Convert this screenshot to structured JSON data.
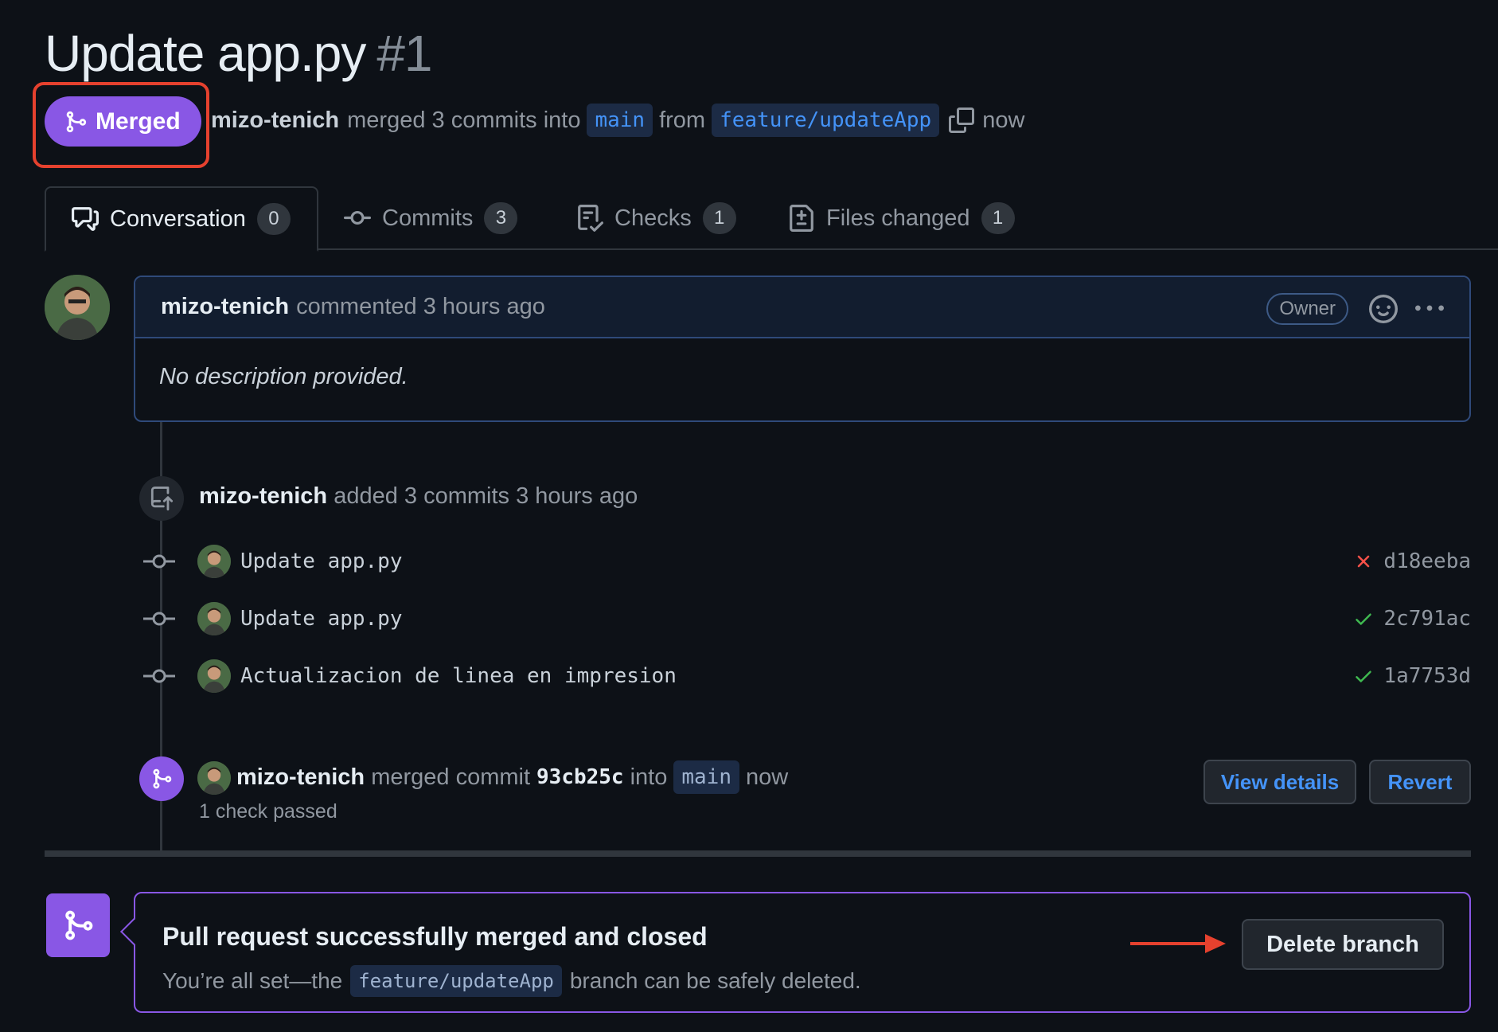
{
  "pr": {
    "title": "Update app.py",
    "number": "#1",
    "state": "Merged",
    "author": "mizo-tenich",
    "merge_text": "merged 3 commits into",
    "base_branch": "main",
    "from_word": "from",
    "head_branch": "feature/updateApp",
    "time": "now"
  },
  "tabs": [
    {
      "label": "Conversation",
      "count": "0",
      "icon": "comment-discussion-icon"
    },
    {
      "label": "Commits",
      "count": "3",
      "icon": "git-commit-icon"
    },
    {
      "label": "Checks",
      "count": "1",
      "icon": "checklist-icon"
    },
    {
      "label": "Files changed",
      "count": "1",
      "icon": "file-diff-icon"
    }
  ],
  "comment": {
    "author": "mizo-tenich",
    "action": "commented 3 hours ago",
    "badge": "Owner",
    "body": "No description provided."
  },
  "push_event": {
    "author": "mizo-tenich",
    "text": "added 3 commits 3 hours ago"
  },
  "commits": [
    {
      "message": "Update app.py",
      "sha": "d18eeba",
      "status": "fail"
    },
    {
      "message": "Update app.py",
      "sha": "2c791ac",
      "status": "pass"
    },
    {
      "message": "Actualizacion de linea en impresion",
      "sha": "1a7753d",
      "status": "pass"
    }
  ],
  "merge_event": {
    "author": "mizo-tenich",
    "text": "merged commit",
    "sha": "93cb25c",
    "into_word": "into",
    "branch": "main",
    "time": "now",
    "checks": "1 check passed",
    "view_details": "View details",
    "revert": "Revert"
  },
  "merged_box": {
    "title": "Pull request successfully merged and closed",
    "sub_prefix": "You’re all set—the",
    "branch": "feature/updateApp",
    "sub_suffix": "branch can be safely deleted.",
    "delete_button": "Delete branch"
  },
  "colors": {
    "merged": "#8957e5",
    "link": "#4493f8",
    "success": "#3fb950",
    "danger": "#f85149",
    "highlight": "#e5412e"
  }
}
